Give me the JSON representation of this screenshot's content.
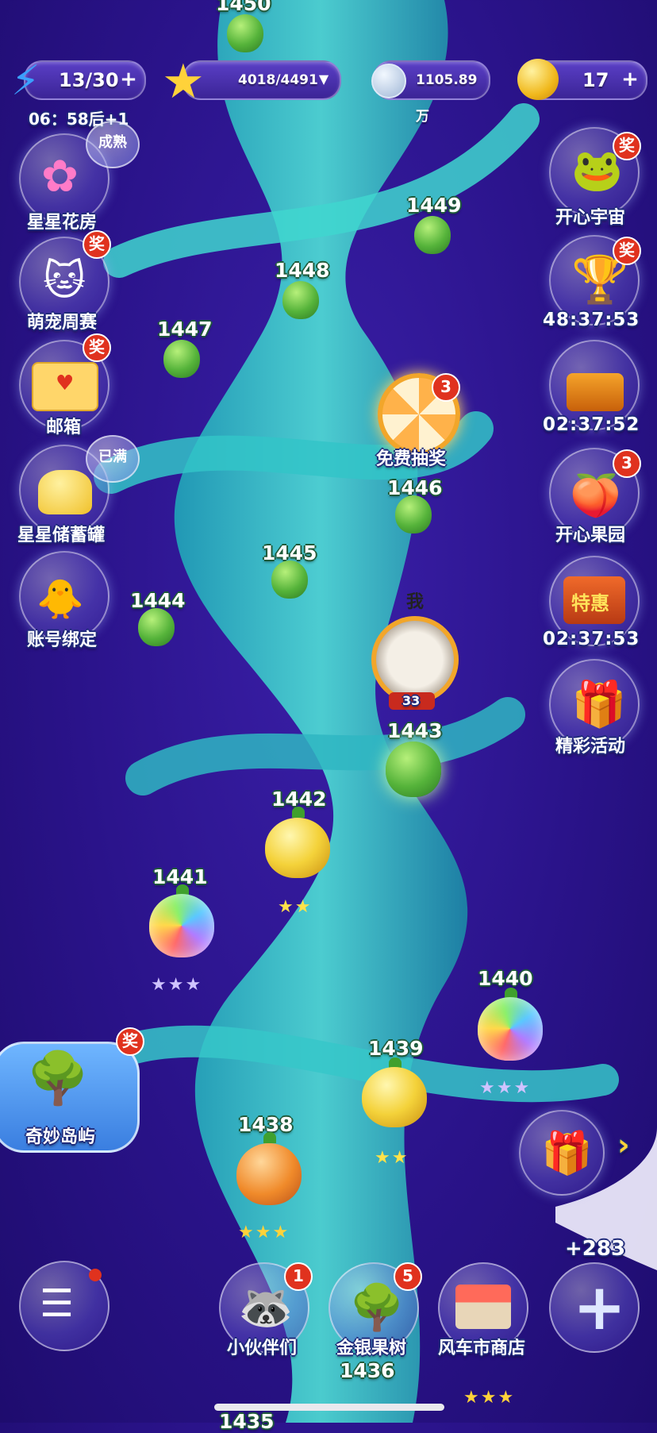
{
  "top_bar": {
    "energy": "13/30",
    "energy_timer": "06：58后+1",
    "stars": "4018/4491",
    "coins": "1105.89万",
    "gems": "17"
  },
  "left_menu": [
    {
      "label": "星星花房",
      "tag": "成熟"
    },
    {
      "label": "萌宠周赛",
      "badge": "奖"
    },
    {
      "label": "邮箱",
      "badge": "奖"
    },
    {
      "label": "星星储蓄罐",
      "tag": "已满"
    },
    {
      "label": "账号绑定"
    }
  ],
  "right_menu": [
    {
      "label": "开心宇宙",
      "badge": "奖"
    },
    {
      "label": "48:37:53",
      "badge": "奖"
    },
    {
      "label": "02:37:52"
    },
    {
      "label": "开心果园",
      "badge": "3"
    },
    {
      "label": "02:37:53",
      "sign": "特惠"
    },
    {
      "label": "精彩活动"
    }
  ],
  "lottery": {
    "label": "免费抽奖",
    "badge": "3"
  },
  "player": {
    "label": "我",
    "level": "33"
  },
  "levels": [
    "1450",
    "1449",
    "1448",
    "1447",
    "1446",
    "1445",
    "1444",
    "1443",
    "1442",
    "1441",
    "1440",
    "1439",
    "1438",
    "1436",
    "1435"
  ],
  "island": {
    "label": "奇妙岛屿",
    "badge": "奖"
  },
  "gift_count": "+283",
  "bottom_nav": [
    {
      "label": "小伙伴们",
      "badge": "1"
    },
    {
      "label": "金银果树",
      "badge": "5"
    },
    {
      "label": "风车市商店"
    }
  ],
  "stars_text": {
    "two": "★★",
    "three": "★★★"
  },
  "icons": {
    "plus": "+",
    "dropdown": "▼",
    "arrow": "›"
  }
}
